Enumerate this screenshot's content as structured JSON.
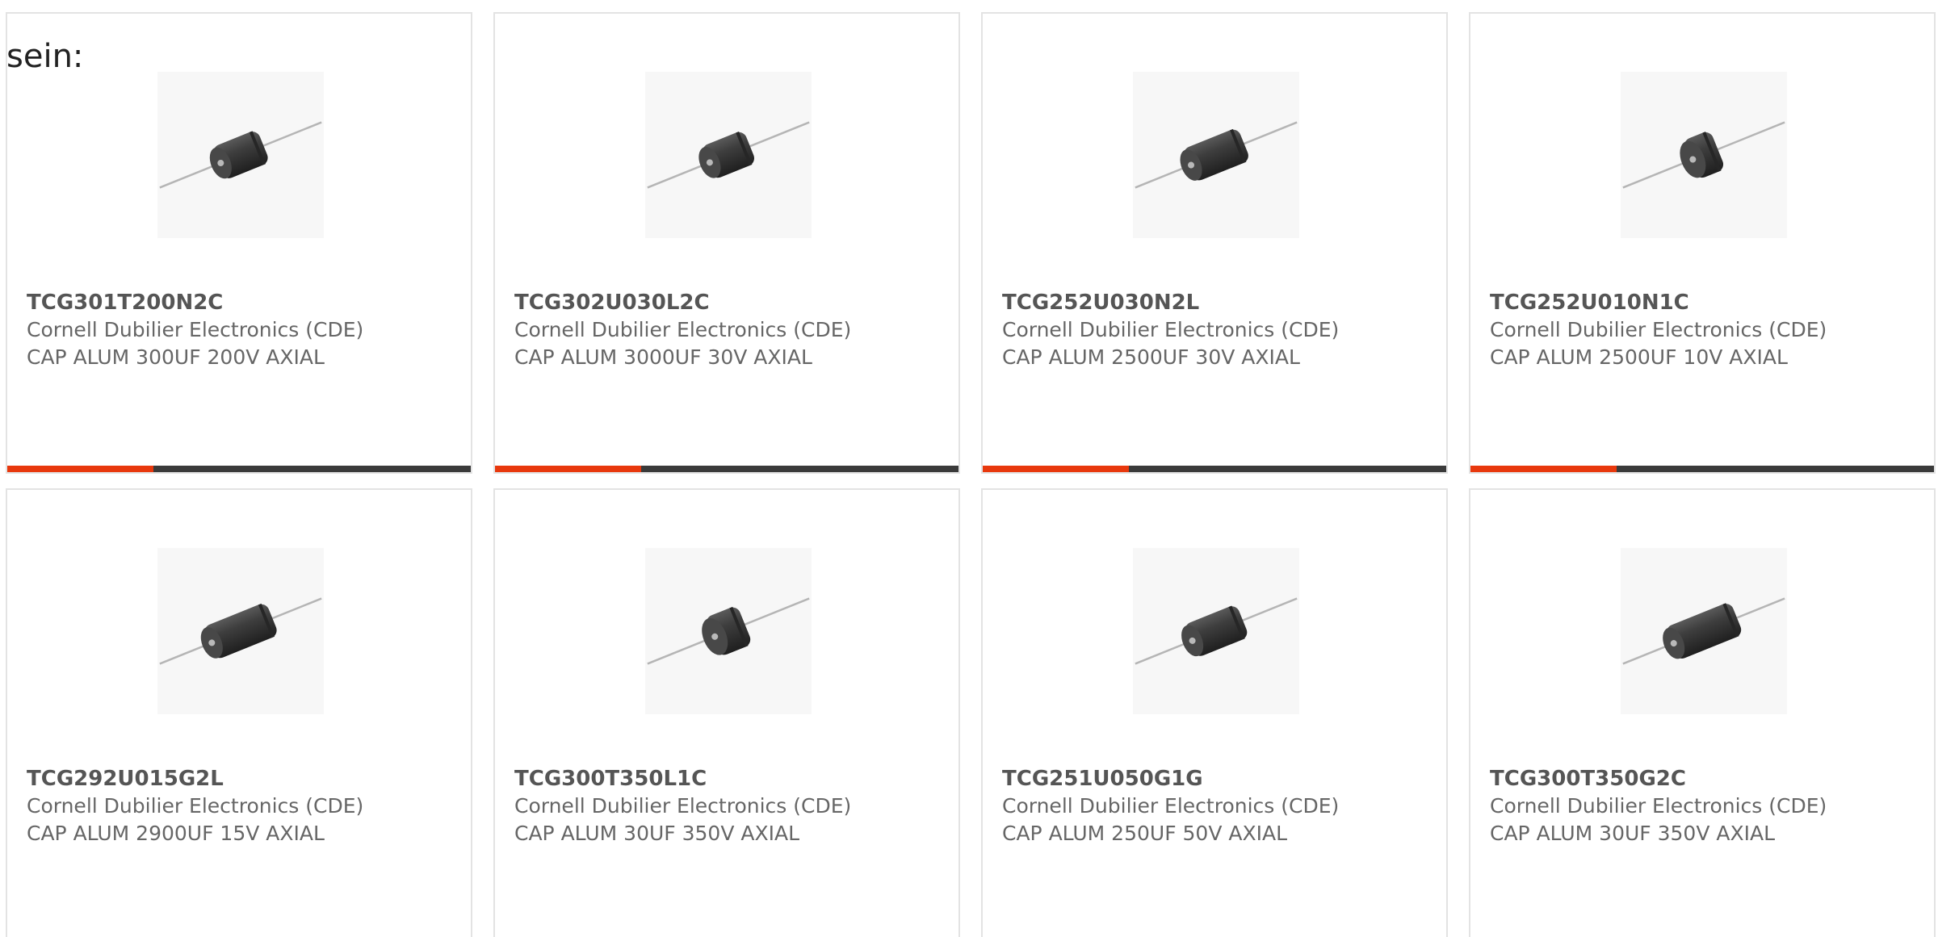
{
  "intro": {
    "text": "sein:"
  },
  "colors": {
    "accent": "#e8380d",
    "bar": "#3a3a3a",
    "border": "#e3e3e3"
  },
  "products": [
    {
      "part_number": "TCG301T200N2C",
      "manufacturer": "Cornell Dubilier Electronics (CDE)",
      "description": "CAP ALUM 300UF 200V AXIAL",
      "image_icon": "capacitor-axial-image",
      "capacitor_length": 0.9,
      "progress": 0.315
    },
    {
      "part_number": "TCG302U030L2C",
      "manufacturer": "Cornell Dubilier Electronics (CDE)",
      "description": "CAP ALUM 3000UF 30V AXIAL",
      "image_icon": "capacitor-axial-image",
      "capacitor_length": 0.85,
      "progress": 0.315
    },
    {
      "part_number": "TCG252U030N2L",
      "manufacturer": "Cornell Dubilier Electronics (CDE)",
      "description": "CAP ALUM 2500UF 30V AXIAL",
      "image_icon": "capacitor-axial-image",
      "capacitor_length": 1.1,
      "progress": 0.315
    },
    {
      "part_number": "TCG252U010N1C",
      "manufacturer": "Cornell Dubilier Electronics (CDE)",
      "description": "CAP ALUM 2500UF 10V AXIAL",
      "image_icon": "capacitor-axial-image",
      "capacitor_length": 0.55,
      "progress": 0.315
    },
    {
      "part_number": "TCG292U015G2L",
      "manufacturer": "Cornell Dubilier Electronics (CDE)",
      "description": "CAP ALUM 2900UF 15V AXIAL",
      "image_icon": "capacitor-axial-image",
      "capacitor_length": 1.25
    },
    {
      "part_number": "TCG300T350L1C",
      "manufacturer": "Cornell Dubilier Electronics (CDE)",
      "description": "CAP ALUM 30UF 350V AXIAL",
      "image_icon": "capacitor-axial-image",
      "capacitor_length": 0.65
    },
    {
      "part_number": "TCG251U050G1G",
      "manufacturer": "Cornell Dubilier Electronics (CDE)",
      "description": "CAP ALUM 250UF 50V AXIAL",
      "image_icon": "capacitor-axial-image",
      "capacitor_length": 1.05
    },
    {
      "part_number": "TCG300T350G2C",
      "manufacturer": "Cornell Dubilier Electronics (CDE)",
      "description": "CAP ALUM 30UF 350V AXIAL",
      "image_icon": "capacitor-axial-image",
      "capacitor_length": 1.3
    }
  ]
}
